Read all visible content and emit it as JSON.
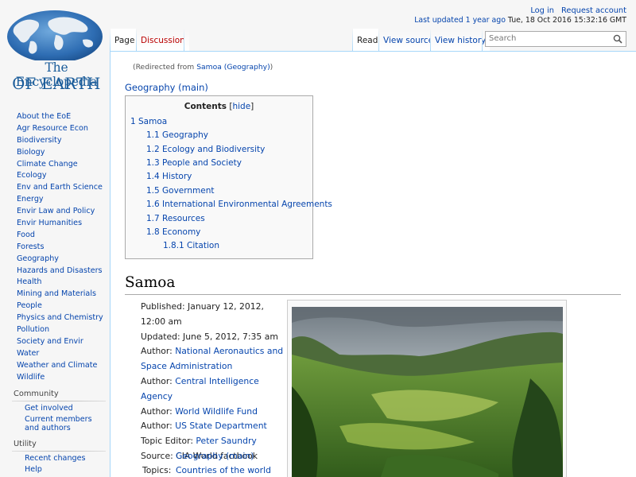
{
  "logo": {
    "line1": "The Encyclopedia",
    "line2": "OF EARTH"
  },
  "sidebar": {
    "items": [
      "About the EoE",
      "Agr Resource Econ",
      "Biodiversity",
      "Biology",
      "Climate Change",
      "Ecology",
      "Env and Earth Science",
      "Energy",
      "Envir Law and Policy",
      "Envir Humanities",
      "Food",
      "Forests",
      "Geography",
      "Hazards and Disasters",
      "Health",
      "Mining and Materials",
      "People",
      "Physics and Chemistry",
      "Pollution",
      "Society and Envir",
      "Water",
      "Weather and Climate",
      "Wildlife"
    ],
    "community": {
      "heading": "Community",
      "items": [
        "Get involved",
        "Current members and authors"
      ]
    },
    "utility": {
      "heading": "Utility",
      "items": [
        "Recent changes",
        "Help"
      ]
    }
  },
  "personal": {
    "login": "Log in",
    "request": "Request account"
  },
  "last_updated": {
    "prefix": "Last updated 1 year ago",
    "date": " Tue, 18 Oct 2016 15:32:16 GMT"
  },
  "tabs": {
    "page": "Page",
    "discussion": "Discussion",
    "read": "Read",
    "view_source": "View source",
    "view_history": "View history"
  },
  "search": {
    "placeholder": "Search"
  },
  "content": {
    "redirect_prefix": "(Redirected from ",
    "redirect_link": "Samoa (Geography)",
    "redirect_suffix": ")",
    "crumb": "Geography (main)",
    "toc": {
      "title": "Contents",
      "hide_open": " [",
      "hide": "hide",
      "hide_close": "]",
      "items": [
        "1 Samoa",
        "1.1 Geography",
        "1.2 Ecology and Biodiversity",
        "1.3 People and Society",
        "1.4 History",
        "1.5 Government",
        "1.6 International Environmental Agreements",
        "1.7 Resources",
        "1.8 Economy",
        "1.8.1 Citation"
      ]
    },
    "title": "Samoa",
    "info": {
      "published": "Published: January 12, 2012, 12:00 am",
      "updated": "Updated: June 5, 2012, 7:35 am",
      "author_label": "Author: ",
      "authors": [
        "National Aeronautics and Space Administration",
        "Central Intelligence Agency",
        "World Wildlife Fund",
        "US State Department"
      ],
      "topic_editor_label": "Topic Editor: ",
      "topic_editor": "Peter Saundry",
      "source": "Source: CIA World factbook",
      "topics_label": "Topics:",
      "topics": [
        "Geography (main)",
        "Countries of the world"
      ]
    }
  },
  "colors": {
    "link": "#0645ad",
    "border": "#a7d7f9",
    "logo": "#1a5c9a"
  }
}
